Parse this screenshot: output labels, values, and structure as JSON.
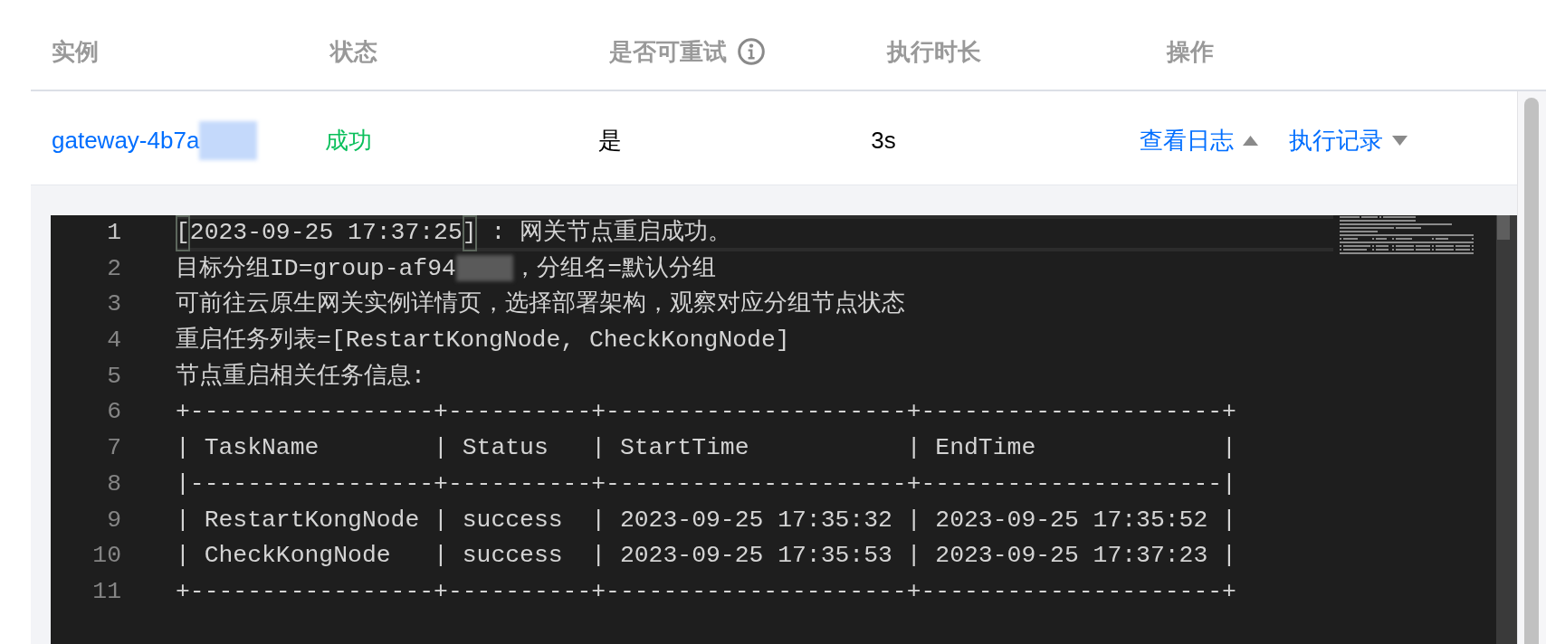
{
  "table": {
    "columns": [
      {
        "label": "实例",
        "info": false
      },
      {
        "label": "状态",
        "info": false
      },
      {
        "label": "是否可重试",
        "info": true
      },
      {
        "label": "执行时长",
        "info": false
      },
      {
        "label": "操作",
        "info": false
      }
    ],
    "rows": [
      {
        "instance": {
          "name": "gateway-4b7a",
          "redacted": true
        },
        "status": {
          "label": "成功",
          "kind": "success"
        },
        "retryable": "是",
        "duration": "3s",
        "actions": [
          {
            "label": "查看日志",
            "expanded": true
          },
          {
            "label": "执行记录",
            "expanded": false
          }
        ],
        "log": {
          "lines": [
            {
              "number": "1",
              "current": true,
              "segments": [
                {
                  "kind": "bracket",
                  "text": "["
                },
                {
                  "kind": "text",
                  "text": "2023-09-25 17:37:25"
                },
                {
                  "kind": "bracket",
                  "text": "]"
                },
                {
                  "kind": "text",
                  "text": " : 网关节点重启成功。"
                }
              ]
            },
            {
              "number": "2",
              "current": false,
              "segments": [
                {
                  "kind": "text",
                  "text": "目标分组ID=group-af94"
                },
                {
                  "kind": "redacted"
                },
                {
                  "kind": "text",
                  "text": "，分组名=默认分组"
                }
              ]
            },
            {
              "number": "3",
              "current": false,
              "text": "可前往云原生网关实例详情页，选择部署架构，观察对应分组节点状态"
            },
            {
              "number": "4",
              "current": false,
              "text": "重启任务列表=[RestartKongNode, CheckKongNode]"
            },
            {
              "number": "5",
              "current": false,
              "text": "节点重启相关任务信息:"
            },
            {
              "number": "6",
              "current": false,
              "text": "+-----------------+----------+---------------------+---------------------+"
            },
            {
              "number": "7",
              "current": false,
              "text": "| TaskName        | Status   | StartTime           | EndTime             |"
            },
            {
              "number": "8",
              "current": false,
              "text": "|-----------------+----------+---------------------+---------------------|"
            },
            {
              "number": "9",
              "current": false,
              "text": "| RestartKongNode | success  | 2023-09-25 17:35:32 | 2023-09-25 17:35:52 |"
            },
            {
              "number": "10",
              "current": false,
              "text": "| CheckKongNode   | success  | 2023-09-25 17:35:53 | 2023-09-25 17:37:23 |"
            },
            {
              "number": "11",
              "current": false,
              "text": "+-----------------+----------+---------------------+---------------------+"
            }
          ]
        }
      }
    ]
  }
}
